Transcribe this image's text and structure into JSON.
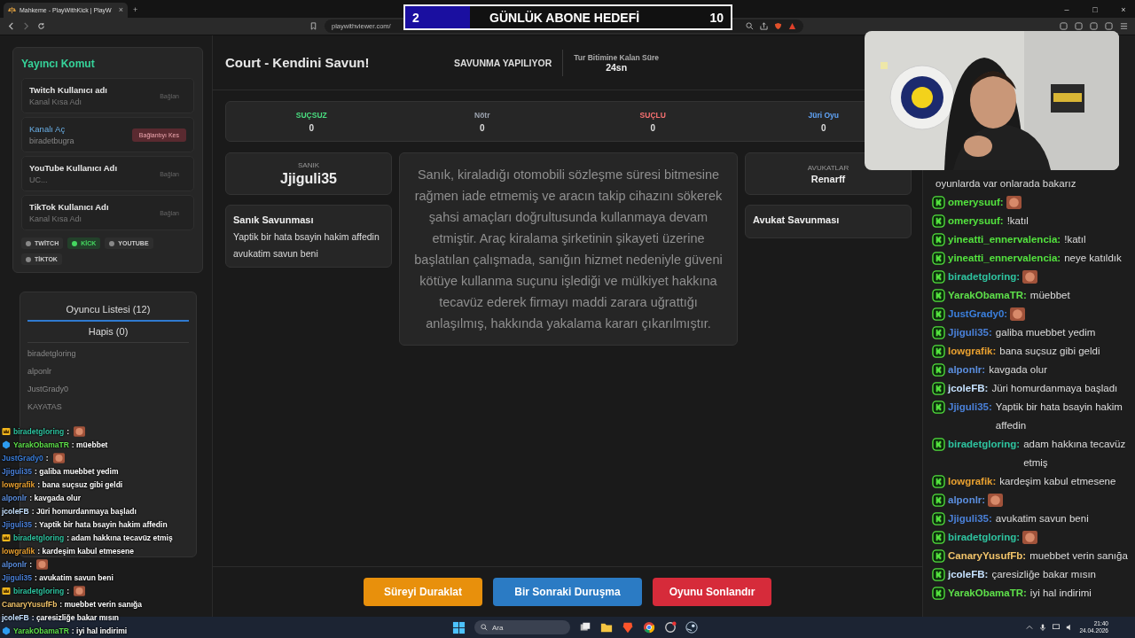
{
  "browser": {
    "tab_title": "Mahkeme - PlayWithKick | PlayW",
    "tab_close": "×",
    "new_tab": "+",
    "url": "playwithviewer.com/",
    "window_controls": [
      "–",
      "□",
      "×"
    ]
  },
  "goal_banner": {
    "current": "2",
    "title": "GÜNLÜK ABONE HEDEFİ",
    "target": "10",
    "level": 0.2
  },
  "streamer_panel": {
    "title": "Yayıncı Komut",
    "accounts": [
      {
        "label": "Twitch Kullanıcı adı",
        "placeholder": "Kanal Kısa Adı",
        "button": "Bağlan",
        "connected": false
      },
      {
        "label": "Kanalı Aç",
        "value": "biradetbugra",
        "button": "Bağlantıyı Kes",
        "connected": true
      },
      {
        "label": "YouTube Kullanıcı Adı",
        "placeholder": "UC...",
        "button": "Bağlan",
        "connected": false
      },
      {
        "label": "TikTok Kullanıcı Adı",
        "placeholder": "Kanal Kısa Adı",
        "button": "Bağlan",
        "connected": false
      }
    ],
    "platforms": [
      {
        "label": "TWİTCH",
        "on": false
      },
      {
        "label": "KİCK",
        "on": true
      },
      {
        "label": "YOUTUBE",
        "on": false
      },
      {
        "label": "TİKTOK",
        "on": false
      }
    ]
  },
  "player_panel": {
    "tabs": [
      {
        "label": "Oyuncu Listesi (12)",
        "selected": true
      },
      {
        "label": "Hapis (0)",
        "selected": false
      }
    ],
    "players": [
      "biradetgloring",
      "alponlr",
      "JustGrady0",
      "KAYATAS"
    ]
  },
  "court": {
    "title": "Court - Kendini Savun!",
    "phase": "SAVUNMA YAPILIYOR",
    "timer_label": "Tur Bitimine Kalan Süre",
    "timer": "24sn"
  },
  "votes": [
    {
      "label": "SUÇSUZ",
      "count": "0",
      "color": "#4ade80"
    },
    {
      "label": "Nötr",
      "count": "0",
      "color": "#9ca3af"
    },
    {
      "label": "SUÇLU",
      "count": "0",
      "color": "#f87171"
    },
    {
      "label": "Jüri Oyu",
      "count": "0",
      "color": "#60a5fa"
    }
  ],
  "defendant": {
    "label": "SANIK",
    "name": "Jjiguli35"
  },
  "defendant_defense": {
    "title": "Sanık Savunması",
    "lines": [
      "Yaptik bir hata bsayin hakim affedin",
      "avukatim savun beni"
    ]
  },
  "charge": "Sanık, kiraladığı otomobili sözleşme süresi bitmesine rağmen iade etmemiş ve aracın takip cihazını sökerek şahsi amaçları doğrultusunda kullanmaya devam etmiştir. Araç kiralama şirketinin şikayeti üzerine başlatılan çalışmada, sanığın hizmet nedeniyle güveni kötüye kullanma suçunu işlediği ve mülkiyet hakkına tecavüz ederek firmayı maddi zarara uğrattığı anlaşılmış, hakkında yakalama kararı çıkarılmıştır.",
  "lawyers": {
    "label": "AVUKATLAR",
    "name": "Renarff"
  },
  "lawyer_defense": {
    "title": "Avukat Savunması"
  },
  "actions": [
    {
      "label": "Süreyi Duraklat",
      "color": "#e8900c"
    },
    {
      "label": "Bir Sonraki Duruşma",
      "color": "#2b7bc4"
    },
    {
      "label": "Oyunu Sonlandır",
      "color": "#d62b3a"
    }
  ],
  "chat": {
    "messages": [
      {
        "text": "oyunlarda var onlarada bakarız",
        "emote": false
      },
      {
        "user": "omerysuuf:",
        "color": "#53e33e",
        "emote": true
      },
      {
        "user": "omerysuuf:",
        "color": "#53e33e",
        "text": "!katıl",
        "emote": false
      },
      {
        "user": "yineatti_ennervalencia:",
        "color": "#53e33e",
        "text": "!katıl",
        "emote": false
      },
      {
        "user": "yineatti_ennervalencia:",
        "color": "#53e33e",
        "text": "neye katıldık",
        "emote": false
      },
      {
        "user": "biradetgloring:",
        "color": "#2ec4a0",
        "emote": true
      },
      {
        "user": "YarakObamaTR:",
        "color": "#5ee04a",
        "text": "müebbet",
        "emote": false
      },
      {
        "user": "JustGrady0:",
        "color": "#3b7fdc",
        "emote": true
      },
      {
        "user": "Jjiguli35:",
        "color": "#4a80d8",
        "text": "galiba muebbet yedim",
        "emote": false
      },
      {
        "user": "lowgrafik:",
        "color": "#e8a030",
        "text": "bana suçsuz gibi geldi",
        "emote": false
      },
      {
        "user": "alponlr:",
        "color": "#5b8ede",
        "text": "kavgada olur",
        "emote": false
      },
      {
        "user": "jcoleFB:",
        "color": "#c6e2ff",
        "text": "Jüri homurdanmaya başladı",
        "emote": false
      },
      {
        "user": "Jjiguli35:",
        "color": "#4a80d8",
        "text": "Yaptik bir hata bsayin hakim affedin",
        "emote": false
      },
      {
        "user": "biradetgloring:",
        "color": "#2ec4a0",
        "text": "adam hakkına tecavüz etmiş",
        "emote": false
      },
      {
        "user": "lowgrafik:",
        "color": "#e8a030",
        "text": "kardeşim kabul etmesene",
        "emote": false
      },
      {
        "user": "alponlr:",
        "color": "#5b8ede",
        "emote": true
      },
      {
        "user": "Jjiguli35:",
        "color": "#4a80d8",
        "text": "avukatim savun beni",
        "emote": false
      },
      {
        "user": "biradetgloring:",
        "color": "#2ec4a0",
        "emote": true
      },
      {
        "user": "CanaryYusufFb:",
        "color": "#f2c46a",
        "text": "muebbet verin sanığa",
        "emote": false
      },
      {
        "user": "jcoleFB:",
        "color": "#c6e2ff",
        "text": "çaresizliğe bakar mısın",
        "emote": false
      },
      {
        "user": "YarakObamaTR:",
        "color": "#5ee04a",
        "text": "iyi hal indirimi",
        "emote": false
      }
    ]
  },
  "overlay_chat": [
    {
      "kind": "crown",
      "user": "biradetgloring",
      "color": "#2ec4a0",
      "text": ":",
      "emote": true
    },
    {
      "kind": "diamond",
      "user": "YarakObamaTR",
      "color": "#5ee04a",
      "text": ": müebbet",
      "emote": false
    },
    {
      "user": "JustGrady0",
      "color": "#3b7fdc",
      "text": ":",
      "emote": true
    },
    {
      "user": "Jjiguli35",
      "color": "#4a80d8",
      "text": ": galiba muebbet yedim",
      "emote": false
    },
    {
      "user": "lowgrafik",
      "color": "#e8a030",
      "text": ": bana suçsuz gibi geldi",
      "emote": false
    },
    {
      "user": "alponlr",
      "color": "#5b8ede",
      "text": ": kavgada olur",
      "emote": false
    },
    {
      "user": "jcoleFB",
      "color": "#c6e2ff",
      "text": ": Jüri homurdanmaya başladı",
      "emote": false
    },
    {
      "user": "Jjiguli35",
      "color": "#4a80d8",
      "text": ": Yaptik bir hata bsayin hakim affedin",
      "emote": false
    },
    {
      "kind": "crown",
      "user": "biradetgloring",
      "color": "#2ec4a0",
      "text": ": adam hakkına tecavüz etmiş",
      "emote": false
    },
    {
      "user": "lowgrafik",
      "color": "#e8a030",
      "text": ": kardeşim kabul etmesene",
      "emote": false
    },
    {
      "user": "alponlr",
      "color": "#5b8ede",
      "text": ":",
      "emote": true
    },
    {
      "user": "Jjiguli35",
      "color": "#4a80d8",
      "text": ": avukatim savun beni",
      "emote": false
    },
    {
      "kind": "crown",
      "user": "biradetgloring",
      "color": "#2ec4a0",
      "text": ":",
      "emote": true
    },
    {
      "user": "CanaryYusufFb",
      "color": "#f2c46a",
      "text": ": muebbet verin sanığa",
      "emote": false
    },
    {
      "user": "jcoleFB",
      "color": "#c6e2ff",
      "text": ": çaresizliğe bakar mısın",
      "emote": false
    },
    {
      "kind": "diamond",
      "user": "YarakObamaTR",
      "color": "#5ee04a",
      "text": ": iyi hal indirimi",
      "emote": false
    }
  ],
  "taskbar": {
    "search_placeholder": "Ara",
    "time": "21:40",
    "date": "24.04.2026"
  }
}
